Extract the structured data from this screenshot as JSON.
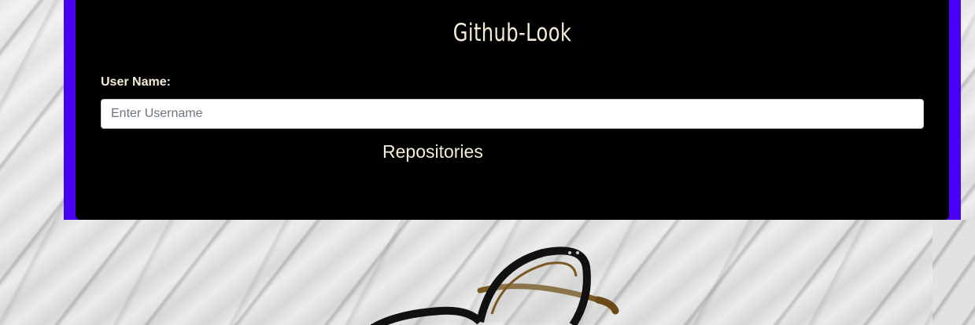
{
  "app": {
    "title": "Github-Look"
  },
  "form": {
    "username_label": "User Name:",
    "username_placeholder": "Enter Username",
    "username_value": ""
  },
  "section": {
    "repositories_heading": "Repositories"
  },
  "colors": {
    "accent_border": "#4a00f5",
    "card_background": "#000000",
    "text": "#f3ecd6"
  }
}
